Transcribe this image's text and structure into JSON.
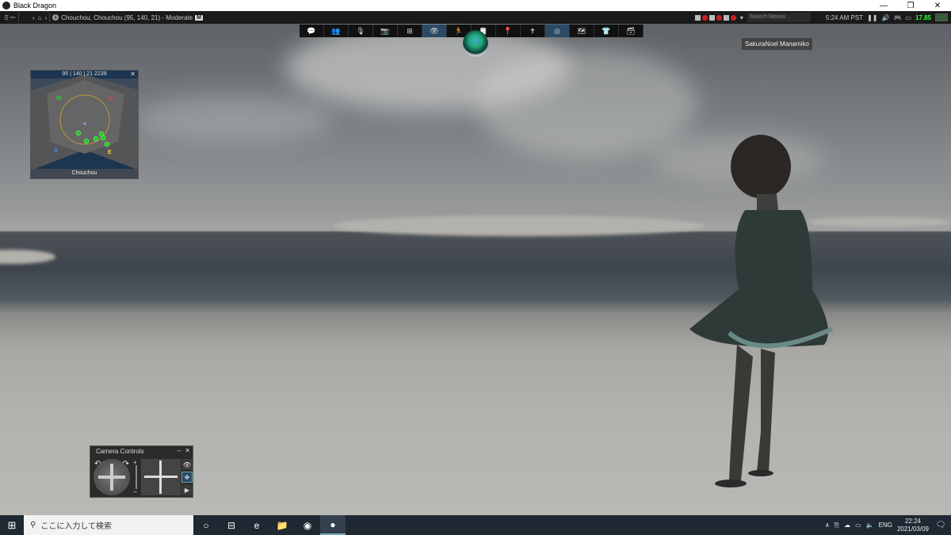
{
  "window": {
    "title": "Black Dragon",
    "controls": [
      "—",
      "❐",
      "✕"
    ]
  },
  "menubar": {
    "menu_label": "ミー",
    "location": "Chouchou, Chouchou (95, 140, 21) - Moderate",
    "rating": "M",
    "search_placeholder": "Search Menus",
    "time": "5:24 AM PST",
    "fps": "17.85"
  },
  "toolbar": {
    "buttons": [
      {
        "icon": "chat-icon",
        "glyph": "💬"
      },
      {
        "icon": "people-icon",
        "glyph": "👥"
      },
      {
        "icon": "voice-icon",
        "glyph": "🎙"
      },
      {
        "icon": "snapshot-icon",
        "glyph": "📷"
      },
      {
        "icon": "build-icon",
        "glyph": "⊞"
      },
      {
        "icon": "camera-icon",
        "glyph": "👁",
        "active": true
      },
      {
        "icon": "move-icon",
        "glyph": "🏃"
      },
      {
        "icon": "places-icon",
        "glyph": "📋"
      },
      {
        "icon": "map-pin-icon",
        "glyph": "📍"
      },
      {
        "icon": "pose-icon",
        "glyph": "✝"
      },
      {
        "icon": "radar-icon",
        "glyph": "◎",
        "active": true
      },
      {
        "icon": "world-map-icon",
        "glyph": "🗺"
      },
      {
        "icon": "appearance-icon",
        "glyph": "👕"
      },
      {
        "icon": "inventory-icon",
        "glyph": "🗃"
      }
    ]
  },
  "avatar_name": "SakuraNoel Manamiko",
  "minimap": {
    "coords": "95 | 140 | 21.2239",
    "close": "✕",
    "region": "Chouchou",
    "directions": {
      "n": "N",
      "s": "S",
      "e": "E",
      "w": "W"
    }
  },
  "camera_controls": {
    "title": "Camera Controls",
    "minimize": "–",
    "close": "✕",
    "zoom_in": "+",
    "zoom_out": "–"
  },
  "taskbar": {
    "start_glyph": "⊞",
    "search_placeholder": "ここに入力して検索",
    "apps": [
      {
        "icon": "task-view-icon",
        "glyph": "○"
      },
      {
        "icon": "timeline-icon",
        "glyph": "⊟"
      },
      {
        "icon": "edge-icon",
        "glyph": "e"
      },
      {
        "icon": "file-explorer-icon",
        "glyph": "📁"
      },
      {
        "icon": "chrome-icon",
        "glyph": "◉"
      },
      {
        "icon": "black-dragon-icon",
        "glyph": "●",
        "running": true
      }
    ],
    "language": "ENG",
    "time": "22:24",
    "date": "2021/03/09"
  }
}
